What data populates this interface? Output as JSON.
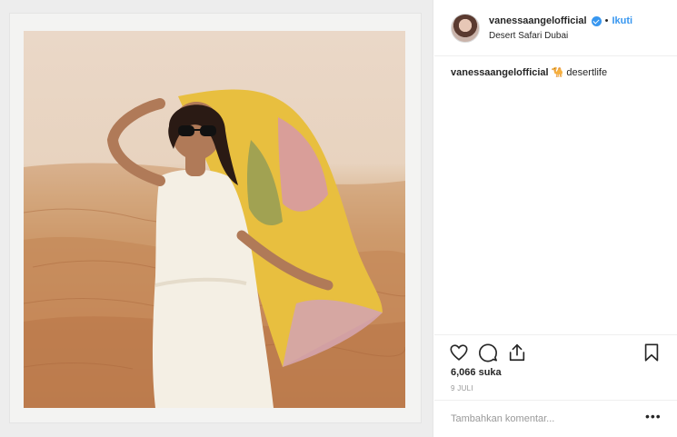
{
  "post": {
    "username": "vanessaangelofficial",
    "follow_label": "Ikuti",
    "separator": "•",
    "location": "Desert Safari Dubai",
    "caption": {
      "username": "vanessaangelofficial",
      "emoji": "🐪",
      "text": " desertlife"
    },
    "likes": "6,066 suka",
    "date": "9 JULI",
    "comment_placeholder": "Tambahkan komentar...",
    "more_label": "•••"
  },
  "colors": {
    "accent": "#3897f0",
    "text": "#262626",
    "muted": "#999999"
  },
  "icons": [
    "verified-badge-icon",
    "heart-icon",
    "comment-icon",
    "share-icon",
    "bookmark-icon",
    "more-options-icon"
  ]
}
